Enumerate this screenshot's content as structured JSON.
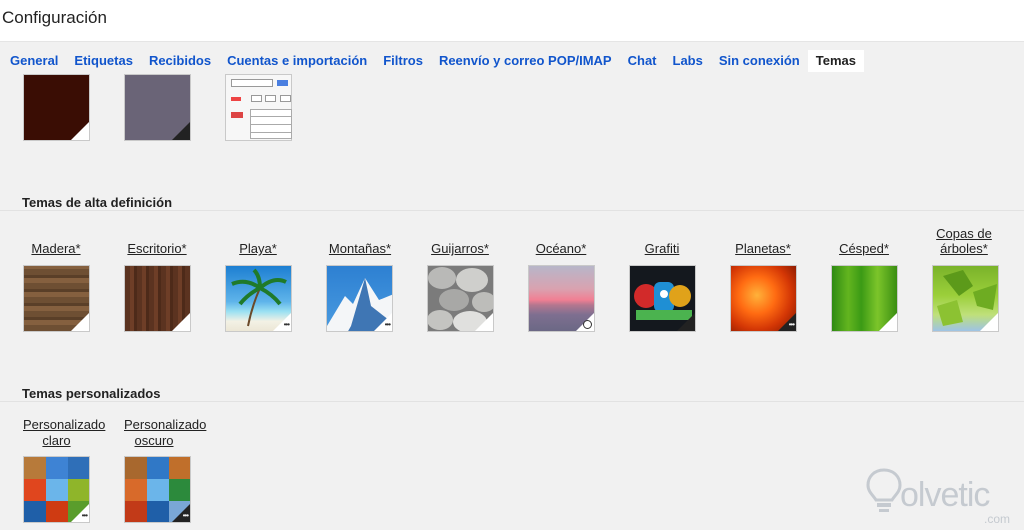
{
  "page": {
    "title": "Configuración"
  },
  "tabs": [
    {
      "label": "General"
    },
    {
      "label": "Etiquetas"
    },
    {
      "label": "Recibidos"
    },
    {
      "label": "Cuentas e importación"
    },
    {
      "label": "Filtros"
    },
    {
      "label": "Reenvío y correo POP/IMAP"
    },
    {
      "label": "Chat"
    },
    {
      "label": "Labs"
    },
    {
      "label": "Sin conexión"
    },
    {
      "label": "Temas",
      "active": true
    }
  ],
  "basic_themes": [
    {
      "name": "dark-brown",
      "color": "#3a0d04"
    },
    {
      "name": "slate",
      "color": "#6a6477"
    },
    {
      "name": "basic-preview"
    }
  ],
  "sections": {
    "hd": {
      "title": "Temas de alta definición"
    },
    "custom": {
      "title": "Temas personalizados"
    }
  },
  "hd_themes": [
    {
      "label": "Madera*"
    },
    {
      "label": "Escritorio*"
    },
    {
      "label": "Playa*"
    },
    {
      "label": "Montañas*"
    },
    {
      "label": "Guijarros*"
    },
    {
      "label": "Océano*"
    },
    {
      "label": "Grafiti"
    },
    {
      "label": "Planetas*"
    },
    {
      "label": "Césped*"
    },
    {
      "label_line1": "Copas de",
      "label_line2": "árboles*"
    }
  ],
  "custom_themes": [
    {
      "label_line1": "Personalizado",
      "label_line2": "claro"
    },
    {
      "label_line1": "Personalizado",
      "label_line2": "oscuro"
    }
  ],
  "icons": {
    "badge": "•••",
    "clock": "clock-icon"
  },
  "colors": {
    "link": "#1155cc",
    "background": "#f1f1f1",
    "active_tab": "#ffffff"
  },
  "watermark": {
    "text": "olvetic",
    "suffix": ".com"
  }
}
